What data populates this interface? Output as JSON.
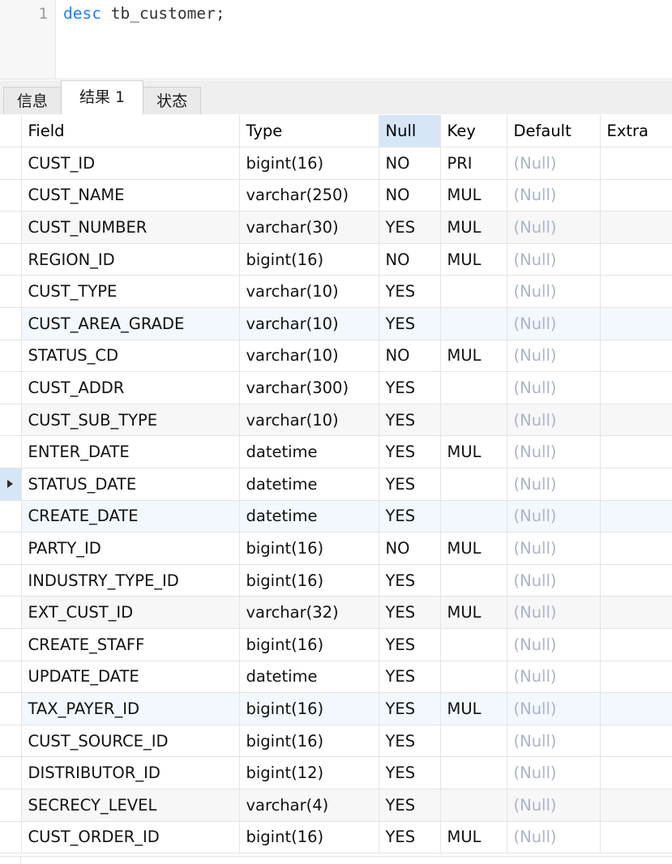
{
  "editor": {
    "line_number": "1",
    "sql_keyword": "desc",
    "sql_rest": " tb_customer;",
    "full_sql": "desc tb_customer;"
  },
  "tabs": [
    {
      "label": "信息",
      "active": false
    },
    {
      "label": "结果 1",
      "active": true
    },
    {
      "label": "状态",
      "active": false
    }
  ],
  "colors": {
    "keyword": "#1d7ffb",
    "selected_column_header": "#d6e6f7",
    "stripe_gray": "#f7f7f7",
    "stripe_blue": "#f2f8fe",
    "null_text": "#aab4cc"
  },
  "grid": {
    "selected_column": "Null",
    "current_row_index": 10,
    "headers": [
      "Field",
      "Type",
      "Null",
      "Key",
      "Default",
      "Extra"
    ],
    "rows": [
      {
        "field": "CUST_ID",
        "type": "bigint(16)",
        "null": "NO",
        "key": "PRI",
        "default": "(Null)",
        "extra": ""
      },
      {
        "field": "CUST_NAME",
        "type": "varchar(250)",
        "null": "NO",
        "key": "MUL",
        "default": "(Null)",
        "extra": ""
      },
      {
        "field": "CUST_NUMBER",
        "type": "varchar(30)",
        "null": "YES",
        "key": "MUL",
        "default": "(Null)",
        "extra": ""
      },
      {
        "field": "REGION_ID",
        "type": "bigint(16)",
        "null": "NO",
        "key": "MUL",
        "default": "(Null)",
        "extra": ""
      },
      {
        "field": "CUST_TYPE",
        "type": "varchar(10)",
        "null": "YES",
        "key": "",
        "default": "(Null)",
        "extra": ""
      },
      {
        "field": "CUST_AREA_GRADE",
        "type": "varchar(10)",
        "null": "YES",
        "key": "",
        "default": "(Null)",
        "extra": ""
      },
      {
        "field": "STATUS_CD",
        "type": "varchar(10)",
        "null": "NO",
        "key": "MUL",
        "default": "(Null)",
        "extra": ""
      },
      {
        "field": "CUST_ADDR",
        "type": "varchar(300)",
        "null": "YES",
        "key": "",
        "default": "(Null)",
        "extra": ""
      },
      {
        "field": "CUST_SUB_TYPE",
        "type": "varchar(10)",
        "null": "YES",
        "key": "",
        "default": "(Null)",
        "extra": ""
      },
      {
        "field": "ENTER_DATE",
        "type": "datetime",
        "null": "YES",
        "key": "MUL",
        "default": "(Null)",
        "extra": ""
      },
      {
        "field": "STATUS_DATE",
        "type": "datetime",
        "null": "YES",
        "key": "",
        "default": "(Null)",
        "extra": ""
      },
      {
        "field": "CREATE_DATE",
        "type": "datetime",
        "null": "YES",
        "key": "",
        "default": "(Null)",
        "extra": ""
      },
      {
        "field": "PARTY_ID",
        "type": "bigint(16)",
        "null": "NO",
        "key": "MUL",
        "default": "(Null)",
        "extra": ""
      },
      {
        "field": "INDUSTRY_TYPE_ID",
        "type": "bigint(16)",
        "null": "YES",
        "key": "",
        "default": "(Null)",
        "extra": ""
      },
      {
        "field": "EXT_CUST_ID",
        "type": "varchar(32)",
        "null": "YES",
        "key": "MUL",
        "default": "(Null)",
        "extra": ""
      },
      {
        "field": "CREATE_STAFF",
        "type": "bigint(16)",
        "null": "YES",
        "key": "",
        "default": "(Null)",
        "extra": ""
      },
      {
        "field": "UPDATE_DATE",
        "type": "datetime",
        "null": "YES",
        "key": "",
        "default": "(Null)",
        "extra": ""
      },
      {
        "field": "TAX_PAYER_ID",
        "type": "bigint(16)",
        "null": "YES",
        "key": "MUL",
        "default": "(Null)",
        "extra": ""
      },
      {
        "field": "CUST_SOURCE_ID",
        "type": "bigint(16)",
        "null": "YES",
        "key": "",
        "default": "(Null)",
        "extra": ""
      },
      {
        "field": "DISTRIBUTOR_ID",
        "type": "bigint(12)",
        "null": "YES",
        "key": "",
        "default": "(Null)",
        "extra": ""
      },
      {
        "field": "SECRECY_LEVEL",
        "type": "varchar(4)",
        "null": "YES",
        "key": "",
        "default": "(Null)",
        "extra": ""
      },
      {
        "field": "CUST_ORDER_ID",
        "type": "bigint(16)",
        "null": "YES",
        "key": "MUL",
        "default": "(Null)",
        "extra": ""
      }
    ]
  }
}
